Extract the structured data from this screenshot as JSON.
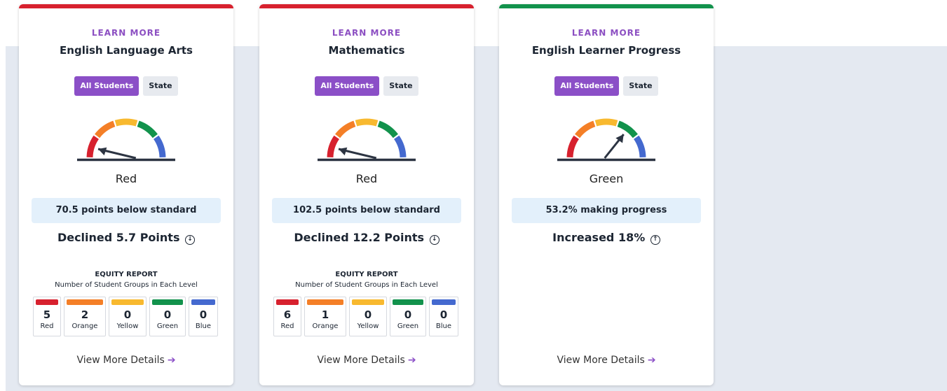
{
  "colors": {
    "red": "#d7212e",
    "orange": "#f47f27",
    "yellow": "#f8b92f",
    "green": "#12924c",
    "blue": "#4469cf",
    "purple": "#8b4fc7"
  },
  "cards": [
    {
      "learn_more": "LEARN MORE",
      "title": "English Language Arts",
      "toggle_all": "All Students",
      "toggle_state": "State",
      "status": "Red",
      "status_color": "red",
      "needle_level": 0.1,
      "info": "70.5 points below standard",
      "change_text": "Declined 5.7 Points",
      "change_direction": "down",
      "equity": {
        "title": "EQUITY REPORT",
        "subtitle": "Number of Student Groups in Each Level",
        "levels": [
          {
            "color": "red",
            "count": "5",
            "label": "Red"
          },
          {
            "color": "orange",
            "count": "2",
            "label": "Orange"
          },
          {
            "color": "yellow",
            "count": "0",
            "label": "Yellow"
          },
          {
            "color": "green",
            "count": "0",
            "label": "Green"
          },
          {
            "color": "blue",
            "count": "0",
            "label": "Blue"
          }
        ]
      },
      "view_more": "View More Details"
    },
    {
      "learn_more": "LEARN MORE",
      "title": "Mathematics",
      "toggle_all": "All Students",
      "toggle_state": "State",
      "status": "Red",
      "status_color": "red",
      "needle_level": 0.1,
      "info": "102.5 points below standard",
      "change_text": "Declined 12.2 Points",
      "change_direction": "down",
      "equity": {
        "title": "EQUITY REPORT",
        "subtitle": "Number of Student Groups in Each Level",
        "levels": [
          {
            "color": "red",
            "count": "6",
            "label": "Red"
          },
          {
            "color": "orange",
            "count": "1",
            "label": "Orange"
          },
          {
            "color": "yellow",
            "count": "0",
            "label": "Yellow"
          },
          {
            "color": "green",
            "count": "0",
            "label": "Green"
          },
          {
            "color": "blue",
            "count": "0",
            "label": "Blue"
          }
        ]
      },
      "view_more": "View More Details"
    },
    {
      "learn_more": "LEARN MORE",
      "title": "English Learner Progress",
      "toggle_all": "All Students",
      "toggle_state": "State",
      "status": "Green",
      "status_color": "green",
      "needle_level": 0.7,
      "info": "53.2% making progress",
      "change_text": "Increased 18%",
      "change_direction": "up",
      "equity": null,
      "view_more": "View More Details"
    }
  ]
}
